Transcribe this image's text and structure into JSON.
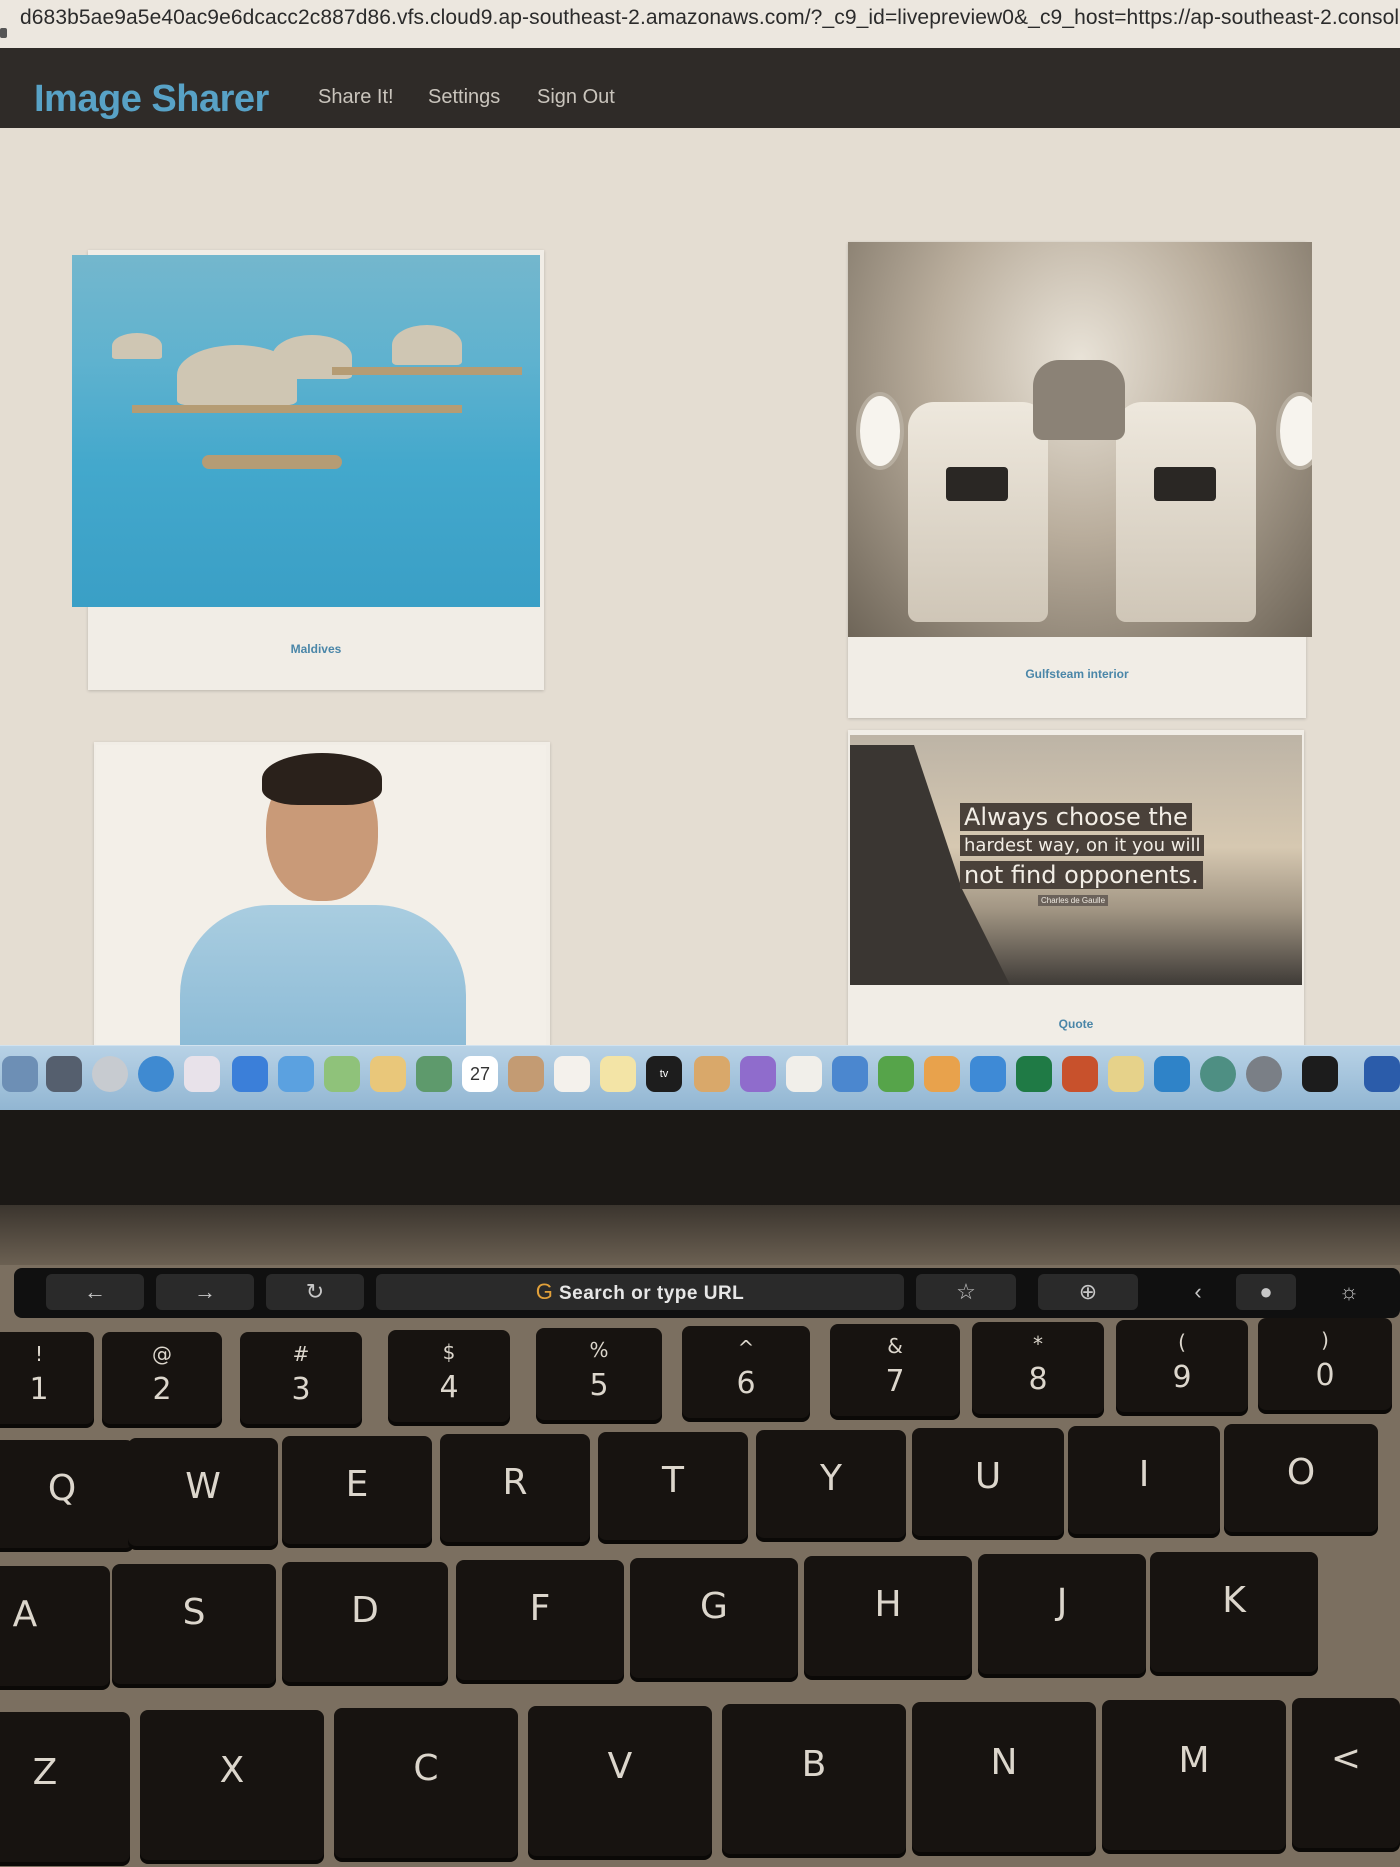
{
  "browser": {
    "url": "d683b5ae9a5e40ac9e6dcacc2c887d86.vfs.cloud9.ap-southeast-2.amazonaws.com/?_c9_id=livepreview0&_c9_host=https://ap-southeast-2.console.aws"
  },
  "app": {
    "brand": "Image Sharer",
    "nav": [
      "Share It!",
      "Settings",
      "Sign Out"
    ]
  },
  "gallery": {
    "cards": [
      {
        "caption": "Maldives"
      },
      {
        "caption": "Gulfsteam interior"
      },
      {
        "caption": ""
      },
      {
        "caption": "Quote"
      }
    ],
    "quote_image": {
      "lines": [
        "Always choose the",
        "hardest way, on it you will",
        "not find opponents."
      ],
      "author": "Charles de Gaulle"
    }
  },
  "dock": {
    "calendar_day": "27",
    "tv_label": "tv"
  },
  "touchbar": {
    "search": "Search or type URL"
  },
  "keyboard": {
    "number_row": [
      {
        "sym": "!",
        "num": "1"
      },
      {
        "sym": "@",
        "num": "2"
      },
      {
        "sym": "#",
        "num": "3"
      },
      {
        "sym": "$",
        "num": "4"
      },
      {
        "sym": "%",
        "num": "5"
      },
      {
        "sym": "^",
        "num": "6"
      },
      {
        "sym": "&",
        "num": "7"
      },
      {
        "sym": "*",
        "num": "8"
      },
      {
        "sym": "(",
        "num": "9"
      },
      {
        "sym": ")",
        "num": "0"
      }
    ],
    "row_q": [
      "Q",
      "W",
      "E",
      "R",
      "T",
      "Y",
      "U",
      "I",
      "O"
    ],
    "row_a": [
      "A",
      "S",
      "D",
      "F",
      "G",
      "H",
      "J",
      "K"
    ],
    "row_z": [
      "Z",
      "X",
      "C",
      "V",
      "B",
      "N",
      "M",
      "<"
    ]
  },
  "colors": {
    "brand": "#58a2c6",
    "navbar": "#2f2b28",
    "caption": "#4a86a8"
  }
}
